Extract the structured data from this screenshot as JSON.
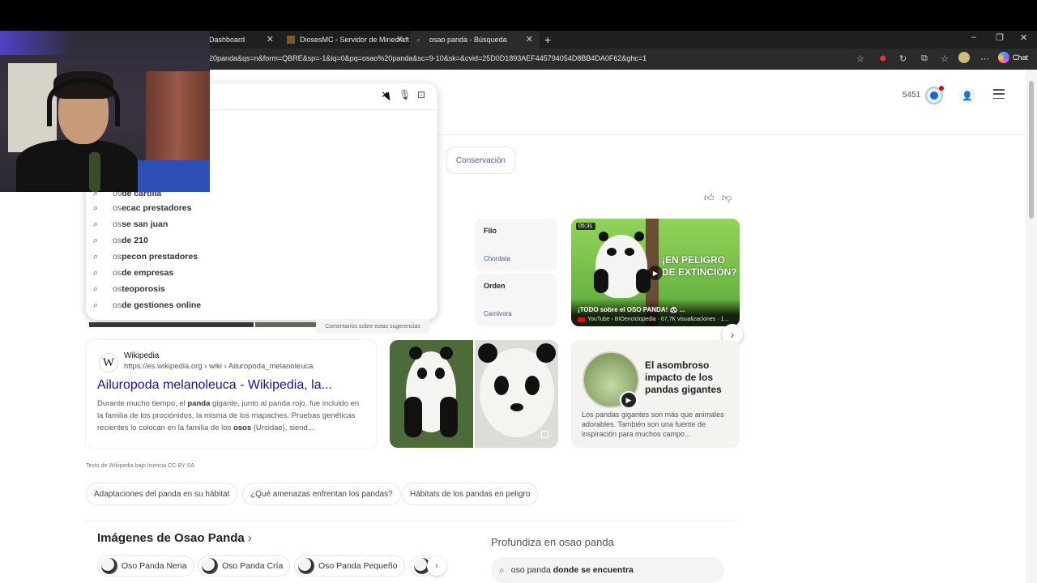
{
  "browser": {
    "tabs": [
      {
        "label": "Dashboard"
      },
      {
        "label": "DiosesMC - Servidor de Minecraft"
      },
      {
        "label": "osao panda - Búsqueda"
      }
    ],
    "new_tab": "+",
    "window_controls": [
      "–",
      "❐",
      "✕"
    ],
    "url": "20panda&qs=n&form=QBRE&sp=-1&lq=0&pq=osao%20panda&sc=9-10&sk=&cvid=25D0D1893AEF445794054D8BB4DA0F62&ghc=1",
    "toolbar_icons": [
      "star-icon",
      "adblock-icon",
      "refresh-icon",
      "extensions-icon",
      "favorites-icon",
      "profile-icon",
      "more-icon"
    ],
    "chat_label": "Chat"
  },
  "header": {
    "rewards_points": "5451",
    "conservation_chip": "Conservación"
  },
  "search_dropdown": {
    "suggestions": [
      {
        "prefix": "os",
        "completion": "de cartilla"
      },
      {
        "prefix": "os",
        "completion": "ecac prestadores"
      },
      {
        "prefix": "os",
        "completion": "se san juan"
      },
      {
        "prefix": "os",
        "completion": "de 210"
      },
      {
        "prefix": "os",
        "completion": "pecon prestadores"
      },
      {
        "prefix": "os",
        "completion": "de empresas"
      },
      {
        "prefix": "os",
        "completion": "teoporosis"
      },
      {
        "prefix": "os",
        "completion": "de gestiones online"
      }
    ],
    "feedback": "Comentarios sobre estas sugerencias"
  },
  "taxonomy": {
    "items": [
      {
        "head": "Filo",
        "value": "Chordata"
      },
      {
        "head": "Orden",
        "value": "Carnivora"
      }
    ]
  },
  "video": {
    "duration": "05:31",
    "overlay_text": "¡EN PELIGRO DE EXTINCIÓN?",
    "title": "¡TODO sobre el OSO PANDA! 🐼 ...",
    "source": "YouTube › BIOenciclopedia · 67,7K visualizaciones · 1..."
  },
  "wiki": {
    "name": "Wikipedia",
    "url": "https://es.wikipedia.org › wiki › Ailuropoda_melanoleuca",
    "title": "Ailuropoda melanoleuca - Wikipedia, la...",
    "desc_parts": [
      "Durante mucho tiempo, el ",
      "panda",
      " gigante, junto al panda rojo, fue incluido en la familia de los prociónidos, la misma de los mapaches. Pruebas genéticas recientes lo colocan en la familia de los ",
      "osos",
      " (Ursidae),   siend..."
    ]
  },
  "amazing": {
    "title": "El asombroso impacto de los pandas gigantes",
    "desc": "Los pandas gigantes son más que animales adorables. También son una fuente de inspiración para muchos campo..."
  },
  "license": "Texto de Wikipedia bajo licencia CC-BY-SA",
  "related_chips": [
    "Adaptaciones del panda en su hábitat",
    "¿Qué amenazas enfrentan los pandas?",
    "Hábitats de los pandas en peligro"
  ],
  "images_section": {
    "title": "Imágenes de Osao Panda",
    "arrow": "›",
    "chips": [
      "Oso Panda Nena",
      "Oso Panda Cría",
      "Oso Panda Pequeño"
    ]
  },
  "deepen": {
    "title": "Profundiza en osao panda",
    "suggestion_prefix": "oso panda",
    "suggestion_bold": "donde se encuentra"
  }
}
